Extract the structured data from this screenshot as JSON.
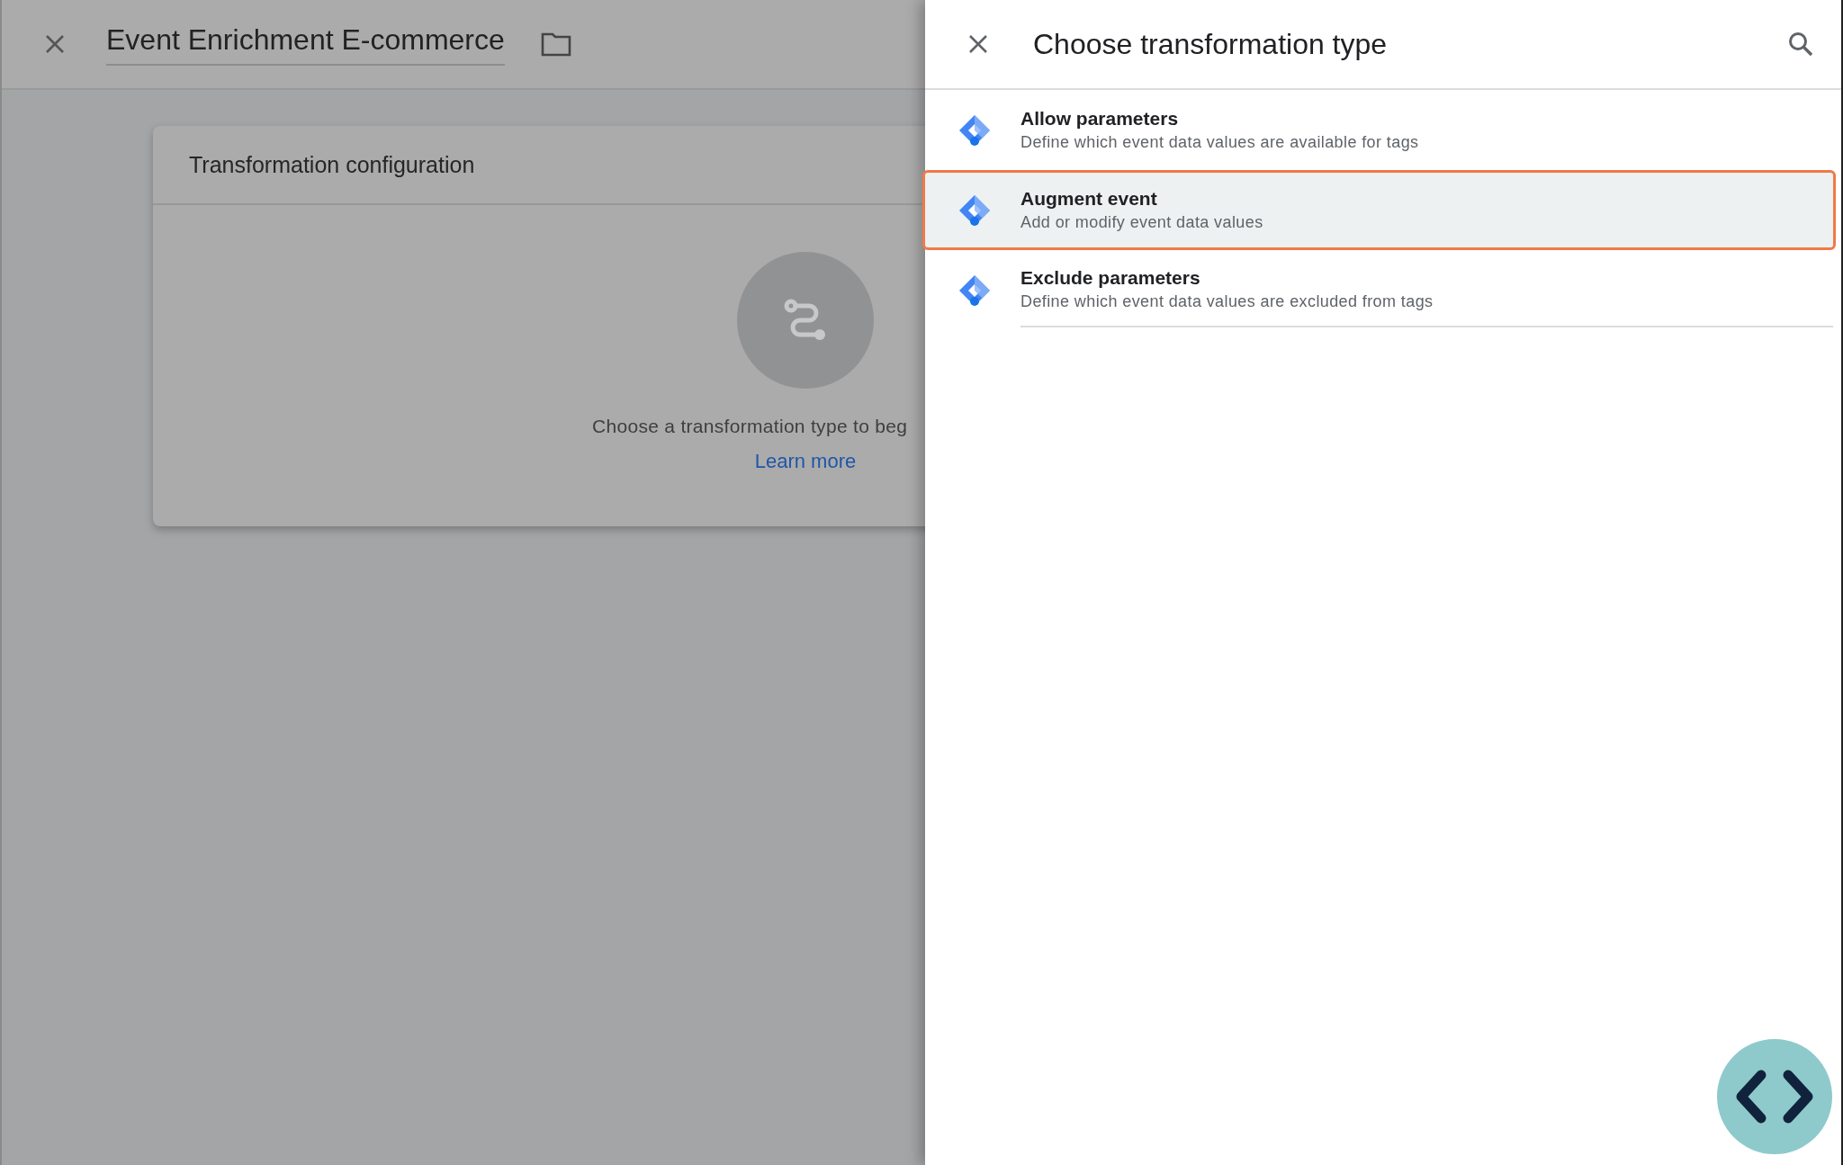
{
  "editor": {
    "title": "Event Enrichment E-commerce",
    "card": {
      "title": "Transformation configuration",
      "empty_message": "Choose a transformation type to beg",
      "link": "Learn more"
    }
  },
  "panel": {
    "title": "Choose transformation type",
    "options": [
      {
        "title": "Allow parameters",
        "description": "Define which event data values are available for tags",
        "selected": false
      },
      {
        "title": "Augment event",
        "description": "Add or modify event data values",
        "selected": true
      },
      {
        "title": "Exclude parameters",
        "description": "Define which event data values are excluded from tags",
        "selected": false
      }
    ]
  }
}
